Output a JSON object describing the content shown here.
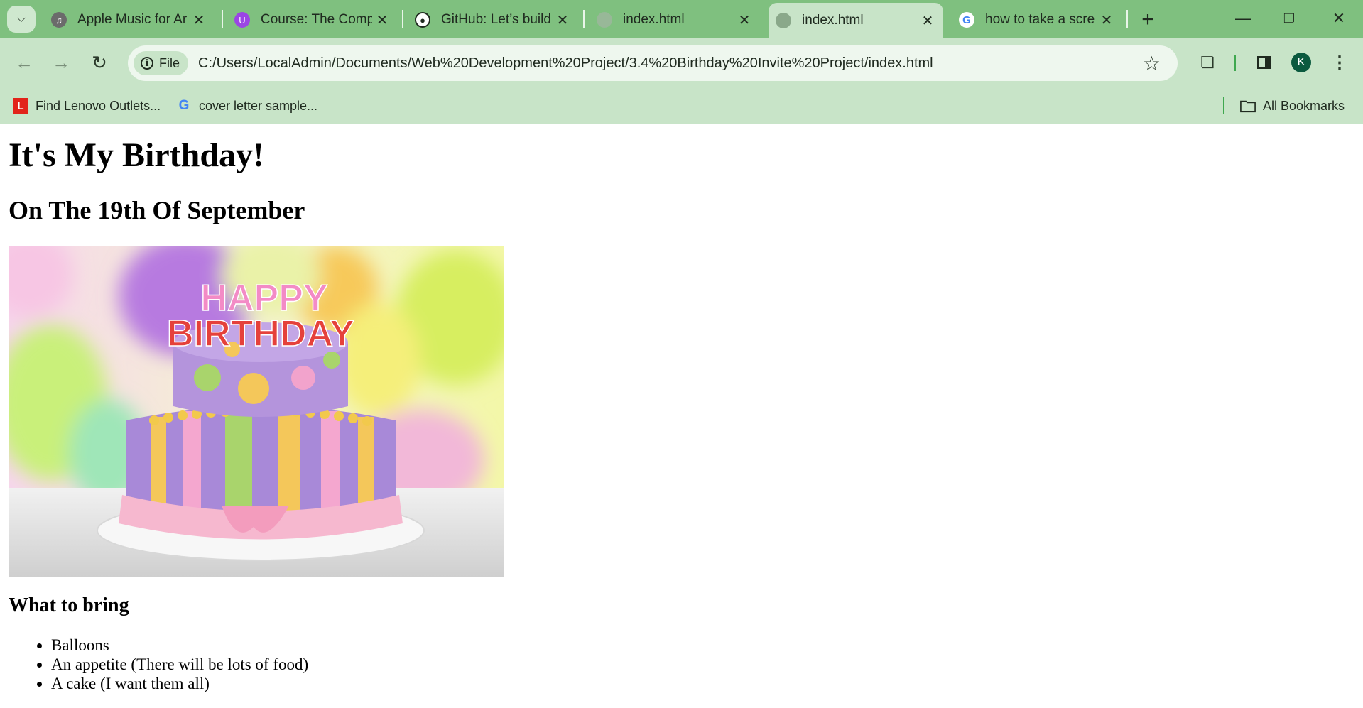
{
  "browser": {
    "tabs": [
      {
        "title": "Apple Music for Ar",
        "active": false
      },
      {
        "title": "Course: The Comp",
        "active": false
      },
      {
        "title": "GitHub: Let’s build",
        "active": false
      },
      {
        "title": "index.html",
        "active": false
      },
      {
        "title": "index.html",
        "active": true
      },
      {
        "title": "how to take a scre",
        "active": false
      }
    ],
    "address": {
      "chip_label": "File",
      "url": "C:/Users/LocalAdmin/Documents/Web%20Development%20Project/3.4%20Birthday%20Invite%20Project/index.html"
    },
    "profile_initial": "K",
    "bookmarks": [
      {
        "label": "Find Lenovo Outlets...",
        "icon": "lenovo-icon"
      },
      {
        "label": "cover letter sample...",
        "icon": "google-icon"
      }
    ],
    "all_bookmarks_label": "All Bookmarks",
    "accent_color": "#7fc07f"
  },
  "page": {
    "heading": "It's My Birthday!",
    "subheading": "On The 19th Of September",
    "cake_lettering": [
      "HAPPY",
      "BIRTHDAY"
    ],
    "list_title": "What to bring",
    "list_items": [
      "Balloons",
      "An appetite (There will be lots of food)",
      "A cake (I want them all)"
    ]
  }
}
